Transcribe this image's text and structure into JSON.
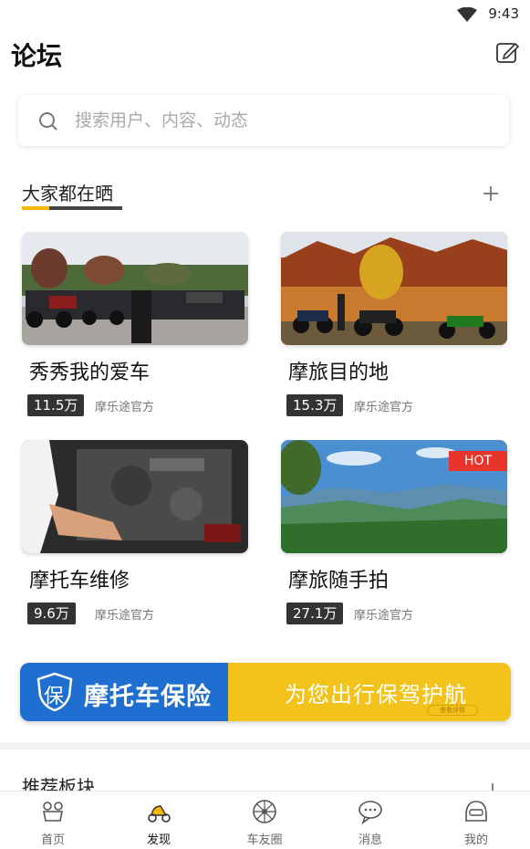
{
  "status_bar": {
    "time": "9:43",
    "wifi_icon": "wifi-icon"
  },
  "header": {
    "title": "论坛",
    "edit_icon": "edit-icon"
  },
  "search": {
    "placeholder": "搜索用户、内容、动态",
    "icon": "search-icon"
  },
  "section_featured": {
    "title": "大家都在晒",
    "add_icon": "plus-icon",
    "accent_color": "#f5b700"
  },
  "cards": [
    {
      "title": "秀秀我的爱车",
      "count": "11.5万",
      "author": "摩乐途官方",
      "hot": false
    },
    {
      "title": "摩旅目的地",
      "count": "15.3万",
      "author": "摩乐途官方",
      "hot": false
    },
    {
      "title": "摩托车维修",
      "count": "9.6万",
      "author": "摩乐途官方",
      "hot": false
    },
    {
      "title": "摩旅随手拍",
      "count": "27.1万",
      "author": "摩乐途官方",
      "hot": true,
      "hot_label": "HOT"
    }
  ],
  "banner": {
    "shield_char": "保",
    "brand": "摩托车保险",
    "slogan": "为您出行保驾护航",
    "detail_label": "查看详情",
    "left_color": "#1f6fd1",
    "right_color": "#f3c21b"
  },
  "section_recommended": {
    "title": "推荐板块"
  },
  "tab_bar": {
    "tabs": [
      {
        "label": "首页",
        "icon": "home-icon",
        "active": false
      },
      {
        "label": "发现",
        "icon": "scooter-icon",
        "active": true
      },
      {
        "label": "车友圈",
        "icon": "wheel-icon",
        "active": false
      },
      {
        "label": "消息",
        "icon": "chat-icon",
        "active": false
      },
      {
        "label": "我的",
        "icon": "helmet-icon",
        "active": false
      }
    ]
  }
}
